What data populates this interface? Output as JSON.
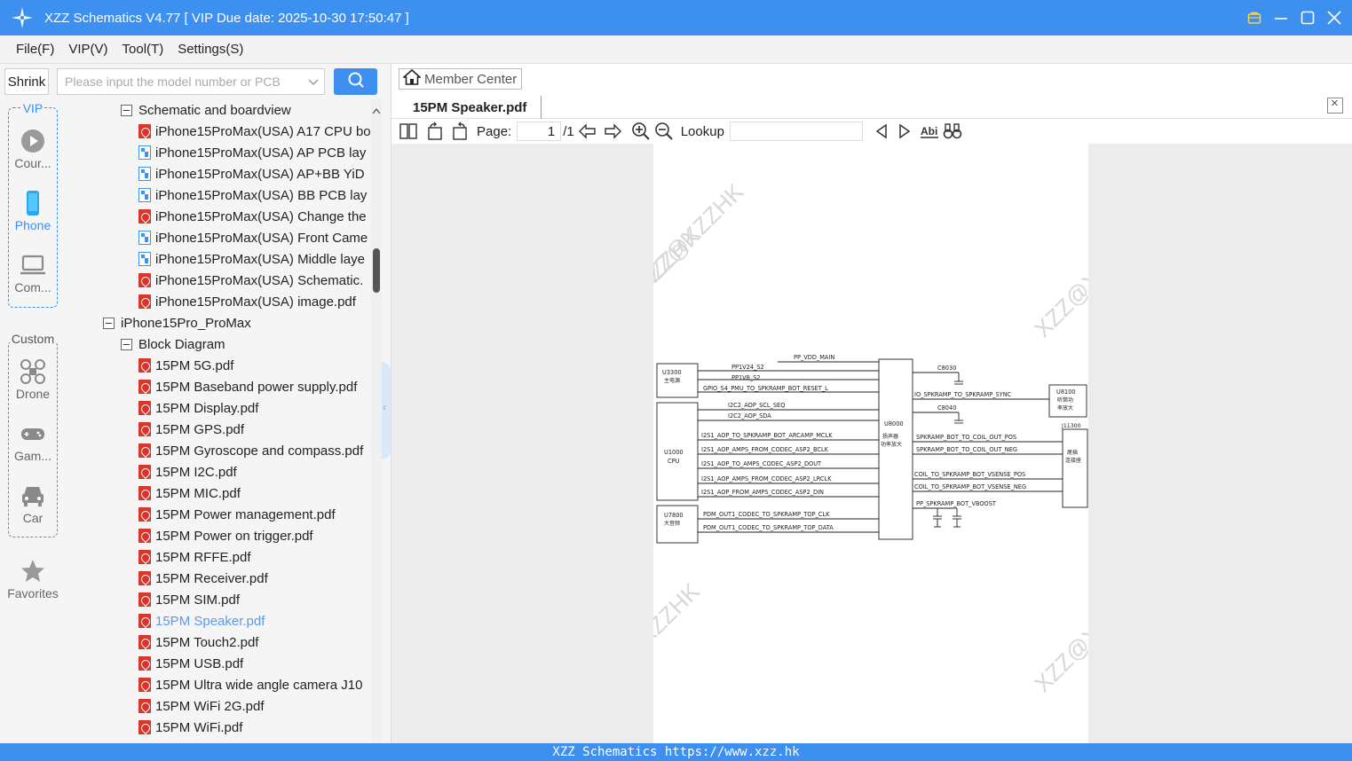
{
  "app": {
    "title": "XZZ Schematics V4.77 [ VIP Due date: 2025-10-30 17:50:47 ]",
    "accent_color": "#3d8ff0"
  },
  "menu": [
    "File(F)",
    "VIP(V)",
    "Tool(T)",
    "Settings(S)"
  ],
  "toolbar": {
    "shrink_label": "Shrink",
    "search_placeholder": "Please input the model number or PCB",
    "search_icon": "search-icon"
  },
  "sidebar": {
    "vip_label": "VIP",
    "custom_label": "Custom",
    "items": [
      {
        "label": "Cour...",
        "icon": "play-icon"
      },
      {
        "label": "Phone",
        "icon": "phone-icon"
      },
      {
        "label": "Com...",
        "icon": "laptop-icon"
      },
      {
        "label": "Drone",
        "icon": "drone-icon"
      },
      {
        "label": "Gam...",
        "icon": "gamepad-icon"
      },
      {
        "label": "Car",
        "icon": "car-icon"
      },
      {
        "label": "Favorites",
        "icon": "star-icon"
      }
    ]
  },
  "tree": [
    {
      "label": "Schematic and boardview",
      "type": "folder"
    },
    {
      "label": "iPhone15ProMax(USA) A17 CPU bo",
      "type": "pdf"
    },
    {
      "label": "iPhone15ProMax(USA) AP PCB lay",
      "type": "pcb"
    },
    {
      "label": "iPhone15ProMax(USA) AP+BB YiD",
      "type": "pcb"
    },
    {
      "label": "iPhone15ProMax(USA) BB PCB lay",
      "type": "pcb"
    },
    {
      "label": "iPhone15ProMax(USA) Change the",
      "type": "pdf"
    },
    {
      "label": "iPhone15ProMax(USA) Front Came",
      "type": "pcb"
    },
    {
      "label": "iPhone15ProMax(USA) Middle laye",
      "type": "pcb"
    },
    {
      "label": "iPhone15ProMax(USA) Schematic.",
      "type": "pdf"
    },
    {
      "label": "iPhone15ProMax(USA) image.pdf",
      "type": "pdf"
    },
    {
      "label": "iPhone15Pro_ProMax",
      "type": "folder"
    },
    {
      "label": "Block Diagram",
      "type": "folder"
    },
    {
      "label": "15PM 5G.pdf",
      "type": "pdf"
    },
    {
      "label": "15PM Baseband power supply.pdf",
      "type": "pdf"
    },
    {
      "label": "15PM Display.pdf",
      "type": "pdf"
    },
    {
      "label": "15PM GPS.pdf",
      "type": "pdf"
    },
    {
      "label": "15PM Gyroscope and compass.pdf",
      "type": "pdf"
    },
    {
      "label": "15PM I2C.pdf",
      "type": "pdf"
    },
    {
      "label": "15PM MIC.pdf",
      "type": "pdf"
    },
    {
      "label": "15PM Power management.pdf",
      "type": "pdf"
    },
    {
      "label": "15PM Power on trigger.pdf",
      "type": "pdf"
    },
    {
      "label": "15PM RFFE.pdf",
      "type": "pdf"
    },
    {
      "label": "15PM Receiver.pdf",
      "type": "pdf"
    },
    {
      "label": "15PM SIM.pdf",
      "type": "pdf"
    },
    {
      "label": "15PM Speaker.pdf",
      "type": "pdf",
      "selected": true
    },
    {
      "label": "15PM Touch2.pdf",
      "type": "pdf"
    },
    {
      "label": "15PM USB.pdf",
      "type": "pdf"
    },
    {
      "label": "15PM Ultra wide angle camera J10",
      "type": "pdf"
    },
    {
      "label": "15PM WiFi 2G.pdf",
      "type": "pdf"
    },
    {
      "label": "15PM WiFi.pdf",
      "type": "pdf"
    }
  ],
  "right": {
    "member_center": "Member Center",
    "tab_label": "15PM Speaker.pdf",
    "page_label": "Page:",
    "page_value": "1",
    "page_total": "/1",
    "lookup_label": "Lookup",
    "lookup_value": ""
  },
  "schematic": {
    "watermark": "XZZ@XZZHK",
    "blocks": {
      "u3300": "U3300",
      "u3300_sub": "主电源",
      "u1000": "U1000",
      "u1000_sub": "CPU",
      "u7800": "U7800",
      "u7800_sub": "大音频",
      "u8000": "U8000",
      "u8000_sub1": "扬声器",
      "u8000_sub2": "功率放大",
      "u8100": "U8100",
      "u8100_sub1": "听筒功",
      "u8100_sub2": "率放大",
      "j11300": "J11300",
      "j11300_sub1": "尾插",
      "j11300_sub2": "连接座"
    },
    "nets": {
      "pp_vdd_main": "PP_VDD_MAIN",
      "pp1v24": "PP1V24_S2",
      "pp1v8": "PP1V8_S2",
      "gpio_reset": "GPIO_S4_PMU_TO_SPKRAMP_BOT_RESET_L",
      "i2c_scl": "I2C2_AOP_SCL_SEQ",
      "i2c_sda": "I2C2_AOP_SDA",
      "mclk": "I2S1_AOP_TO_SPKRAMP_BOT_ARCAMP_MCLK",
      "bclk": "I2S1_AOP_AMPS_FROM_CODEC_ASP2_BCLK",
      "dout": "I2S1_AOP_TO_AMPS_CODEC_ASP2_DOUT",
      "lrclk": "I2S1_AOP_AMPS_FROM_CODEC_ASP2_LRCLK",
      "din": "I2S1_AOP_FROM_AMPS_CODEC_ASP2_DIN",
      "pdm_clk": "PDM_OUT1_CODEC_TO_SPKRAMP_TOP_CLK",
      "pdm_data": "PDM_OUT1_CODEC_TO_SPKRAMP_TOP_DATA",
      "c8030": "C8030",
      "c8040": "C8040",
      "sync": "IO_SPKRAMP_TO_SPKRAMP_SYNC",
      "coil_pos": "SPKRAMP_BOT_TO_COIL_OUT_POS",
      "coil_neg": "SPKRAMP_BOT_TO_COIL_OUT_NEG",
      "vsense_pos": "COIL_TO_SPKRAMP_BOT_VSENSE_POS",
      "vsense_neg": "COIL_TO_SPKRAMP_BOT_VSENSE_NEG",
      "vboost": "PP_SPKRAMP_BOT_VBOOST"
    }
  },
  "statusbar": "XZZ Schematics https://www.xzz.hk"
}
